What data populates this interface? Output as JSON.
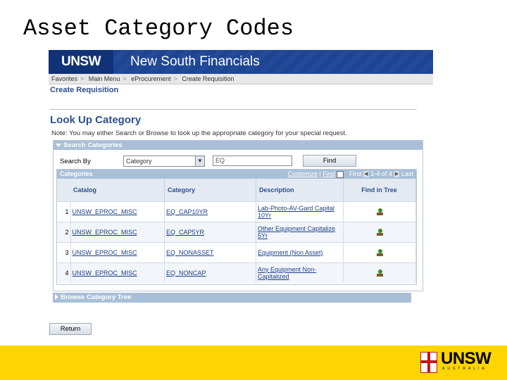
{
  "slide": {
    "title": "Asset Category Codes"
  },
  "banner": {
    "logo_text": "UNSW",
    "title": "New South Financials"
  },
  "breadcrumb": {
    "items": [
      "Favorites",
      "Main Menu",
      "eProcurement",
      "Create Requisition"
    ],
    "separator": ">"
  },
  "page": {
    "create_requisition": "Create Requisition",
    "lookup_title": "Look Up Category",
    "note": "Note: You may either Search or Browse to look up the appropriate category for your special request."
  },
  "search": {
    "section_title": "Search Categories",
    "search_by_label": "Search By",
    "select_value": "Category",
    "input_value": "EQ",
    "find_label": "Find"
  },
  "grid": {
    "title": "Categories",
    "customize": "Customize",
    "find": "Find",
    "first": "First",
    "range": "1-4 of 4",
    "last": "Last",
    "columns": [
      "Catalog",
      "Category",
      "Description",
      "Find in Tree"
    ],
    "rows": [
      {
        "num": "1",
        "catalog": "UNSW_EPROC_MISC",
        "category": "EQ_CAP10YR",
        "description": "Lab-Photo-AV-Gard Capital 10Yr"
      },
      {
        "num": "2",
        "catalog": "UNSW_EPROC_MISC",
        "category": "EQ_CAP5YR",
        "description": "Other Equipment Capitalize 5Yr"
      },
      {
        "num": "3",
        "catalog": "UNSW_EPROC_MISC",
        "category": "EQ_NONASSET",
        "description": "Equipment (Non Asset)"
      },
      {
        "num": "4",
        "catalog": "UNSW_EPROC_MISC",
        "category": "EQ_NONCAP",
        "description": "Any Equipment Non-Capitalized"
      }
    ]
  },
  "browse": {
    "title": "Browse Category Tree"
  },
  "buttons": {
    "return_label": "Return"
  },
  "footer": {
    "logo_text": "UNSW",
    "sub_text": "AUSTRALIA"
  },
  "colors": {
    "banner": "#1c3f8a",
    "footer": "#ffd500",
    "panel_header": "#a9bfd7"
  }
}
